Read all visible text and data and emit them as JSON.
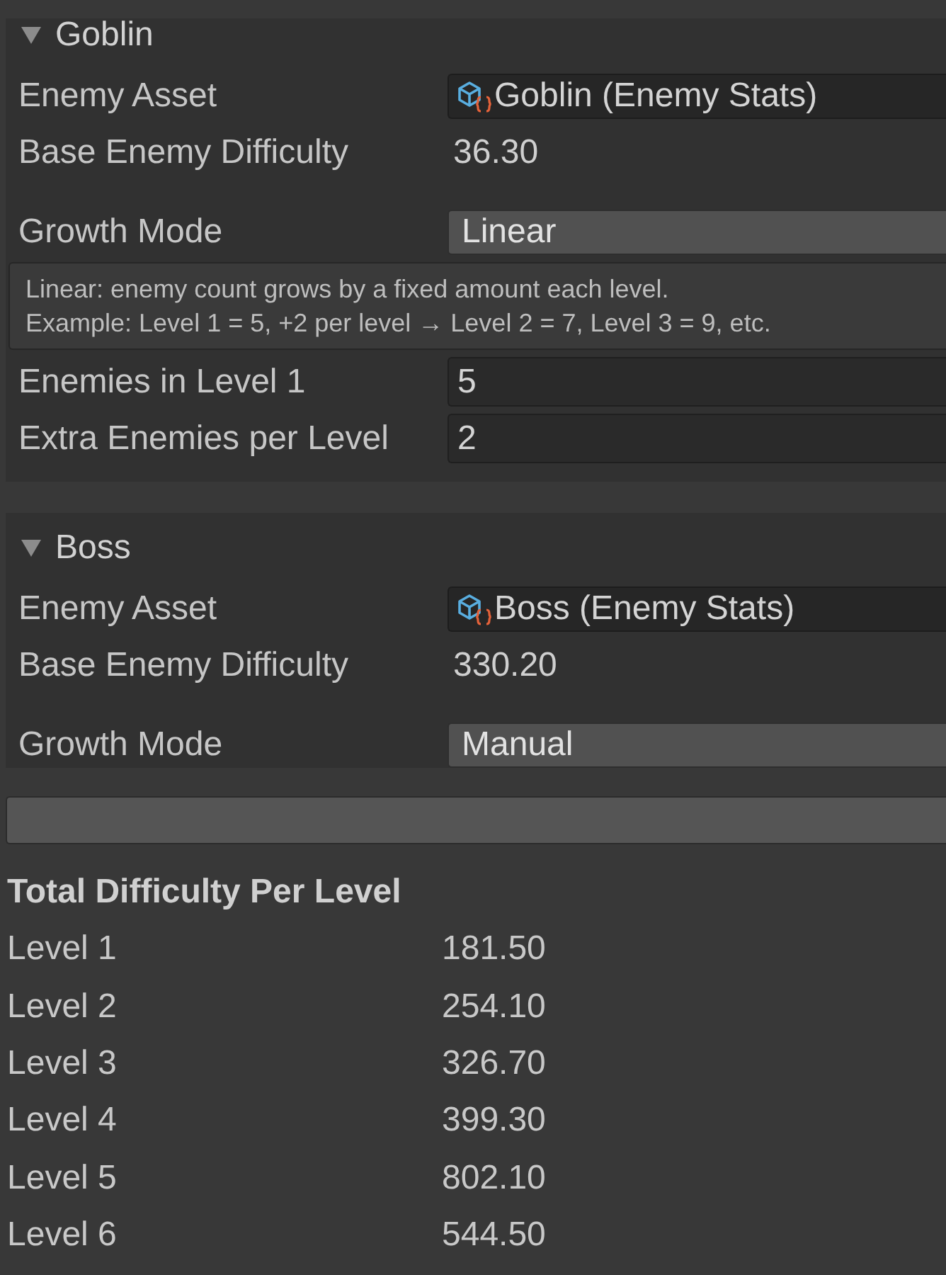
{
  "sections": [
    {
      "title": "Goblin",
      "expanded": true,
      "fields": [
        {
          "kind": "object",
          "label": "Enemy Asset",
          "value": "Goblin (Enemy Stats)"
        },
        {
          "kind": "value",
          "label": "Base Enemy Difficulty",
          "value": "36.30"
        },
        {
          "kind": "dropdown",
          "label": "Growth Mode",
          "value": "Linear"
        },
        {
          "kind": "help",
          "lines": [
            "Linear: enemy count grows by a fixed amount each level.",
            "Example: Level 1 = 5, +2 per level → Level 2 = 7, Level 3 = 9, etc."
          ]
        },
        {
          "kind": "number",
          "label": "Enemies in Level 1",
          "value": "5"
        },
        {
          "kind": "number",
          "label": "Extra Enemies per Level",
          "value": "2"
        }
      ]
    },
    {
      "title": "Boss",
      "expanded": true,
      "fields": [
        {
          "kind": "object",
          "label": "Enemy Asset",
          "value": "Boss (Enemy Stats)"
        },
        {
          "kind": "value",
          "label": "Base Enemy Difficulty",
          "value": "330.20"
        },
        {
          "kind": "dropdown",
          "label": "Growth Mode",
          "value": "Manual"
        }
      ]
    }
  ],
  "summary": {
    "title": "Total Difficulty Per Level",
    "rows": [
      {
        "label": "Level 1",
        "value": "181.50"
      },
      {
        "label": "Level 2",
        "value": "254.10"
      },
      {
        "label": "Level 3",
        "value": "326.70"
      },
      {
        "label": "Level 4",
        "value": "399.30"
      },
      {
        "label": "Level 5",
        "value": "802.10"
      },
      {
        "label": "Level 6",
        "value": "544.50"
      }
    ]
  }
}
